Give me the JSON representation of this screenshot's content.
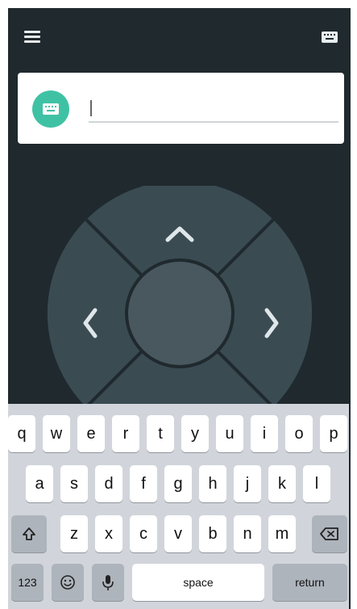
{
  "input": {
    "value": "",
    "placeholder": ""
  },
  "keyboard": {
    "row1": [
      "q",
      "w",
      "e",
      "r",
      "t",
      "y",
      "u",
      "i",
      "o",
      "p"
    ],
    "row2": [
      "a",
      "s",
      "d",
      "f",
      "g",
      "h",
      "j",
      "k",
      "l"
    ],
    "row3": [
      "z",
      "x",
      "c",
      "v",
      "b",
      "n",
      "m"
    ],
    "numbers_label": "123",
    "space_label": "space",
    "return_label": "return"
  },
  "colors": {
    "app_bg": "#1f292e",
    "dpad_outer": "#3a4b52",
    "dpad_center": "#48585e",
    "accent": "#3fc2a4",
    "keyboard_bg": "#d1d5db"
  },
  "icons": {
    "menu": "menu-icon",
    "keyboard_top": "keyboard-icon",
    "avatar": "keyboard-icon",
    "up": "chevron-up-icon",
    "left": "chevron-left-icon",
    "right": "chevron-right-icon",
    "shift": "shift-icon",
    "backspace": "backspace-icon",
    "emoji": "emoji-icon",
    "mic": "microphone-icon"
  }
}
